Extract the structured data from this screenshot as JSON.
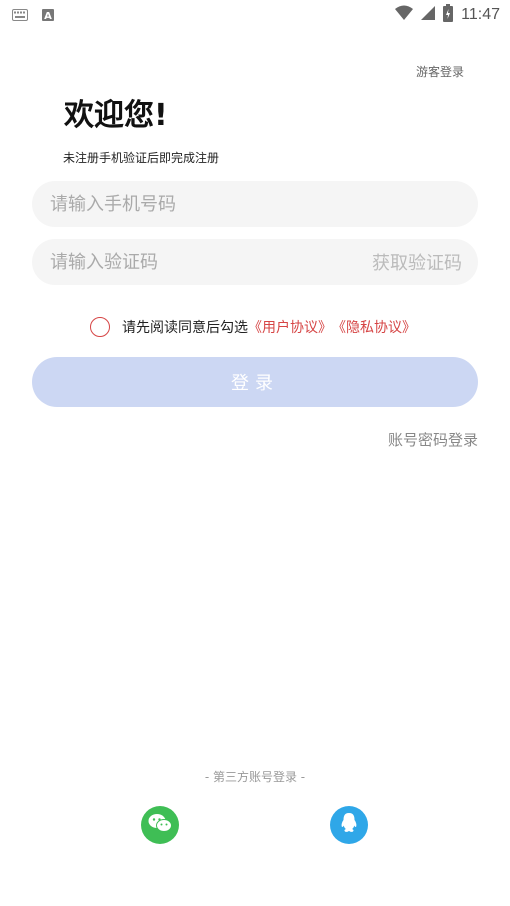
{
  "status_bar": {
    "time": "11:47",
    "left_icons": [
      "keyboard-icon",
      "a-icon"
    ],
    "right_icons": [
      "wifi-icon",
      "signal-icon",
      "battery-icon"
    ]
  },
  "guest_login": "游客登录",
  "welcome": {
    "title": "欢迎您!",
    "subtitle": "未注册手机验证后即完成注册"
  },
  "phone_input": {
    "placeholder": "请输入手机号码",
    "value": ""
  },
  "code_input": {
    "placeholder": "请输入验证码",
    "value": ""
  },
  "get_code_label": "获取验证码",
  "agreement": {
    "checked": false,
    "prefix": "请先阅读同意后勾选",
    "user_agreement": "《用户协议》",
    "privacy_agreement": "《隐私协议》"
  },
  "login_button_label": "登录",
  "account_password_login": "账号密码登录",
  "third_party": {
    "title": "- 第三方账号登录 -",
    "providers": [
      "wechat-icon",
      "qq-icon"
    ]
  },
  "colors": {
    "accent_red": "#d64545",
    "login_button_bg": "#ccd7f3",
    "wechat_green": "#3fbe55",
    "qq_blue": "#2fa7e8"
  }
}
